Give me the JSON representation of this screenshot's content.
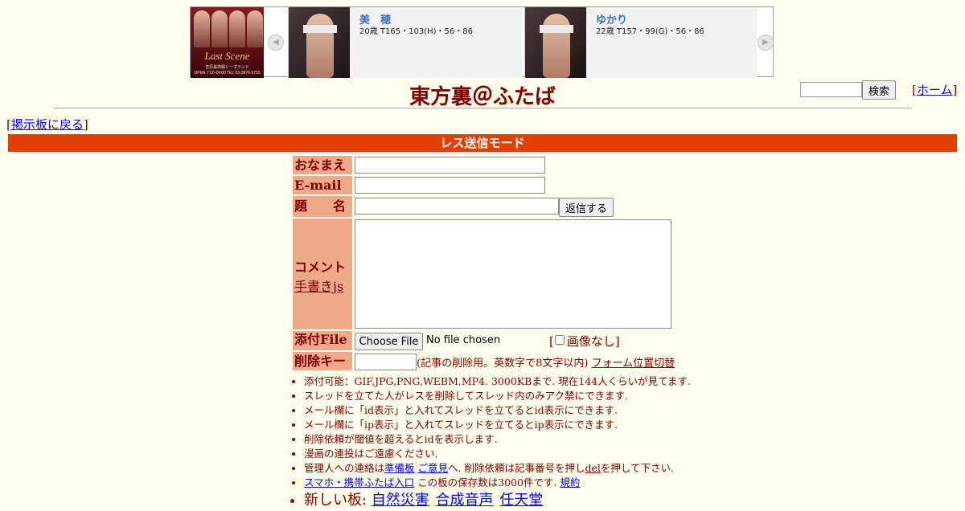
{
  "banner": {
    "shop_logo_text": "Last Scene",
    "shop_logo_sub": "吉原最高級ソープランド\nOPEN 7:00-24:00  TEL 03-3876-5755",
    "prev_arrow": "◀",
    "next_arrow": "▶",
    "cards": [
      {
        "name": "美　穂",
        "stats": "20歳 T165・103(H)・56・86"
      },
      {
        "name": "ゆかり",
        "stats": "22歳 T157・99(G)・56・86"
      }
    ]
  },
  "header": {
    "title": "東方裏＠ふたば",
    "search_button": "検索",
    "home_link": "ホーム"
  },
  "nav": {
    "back_link": "掲示板に戻る"
  },
  "mode_bar": "レス送信モード",
  "form": {
    "name_label": "おなまえ",
    "email_label": "E-mail",
    "subject_label": "題　　名",
    "submit_button": "返信する",
    "comment_label": "コメント",
    "handwrite_link": "手書きjs",
    "file_label": "添付File",
    "file_button": "Choose File",
    "file_status": "No file chosen",
    "no_image_label": "画像なし",
    "delkey_label": "削除キー",
    "delkey_note": "(記事の削除用。英数字で8文字以内)",
    "form_position_link": "フォーム位置切替"
  },
  "notes": {
    "line1": "添付可能：GIF,JPG,PNG,WEBM,MP4. 3000KBまで. 現在144人くらいが見てます.",
    "line2": "スレッドを立てた人がレスを削除してスレッド内のみアク禁にできます.",
    "line3": "メール欄に「id表示」と入れてスレッドを立てるとid表示にできます.",
    "line4": "メール欄に「ip表示」と入れてスレッドを立てるとip表示にできます.",
    "line5": "削除依頼が閾値を超えるとidを表示します.",
    "line6": "漫画の連投はご遠慮ください.",
    "line7_pre": "管理人への連絡は",
    "line7_link1": "準備板",
    "line7_link2": "ご意見",
    "line7_mid": "へ. 削除依頼は記事番号を押し",
    "line7_del": "del",
    "line7_post": "を押して下さい.",
    "line8_link": "スマホ・携帯ふたば入口",
    "line8_mid": " この板の保存数は3000件です. ",
    "line8_rules": "規約",
    "new_boards_label": "新しい板:",
    "new_boards": [
      "自然災害",
      "合成音声",
      "任天堂"
    ]
  }
}
